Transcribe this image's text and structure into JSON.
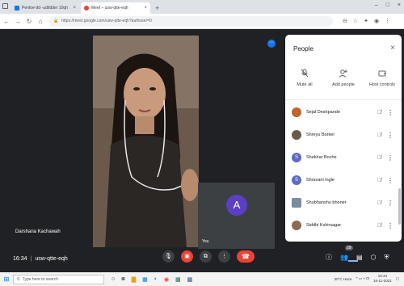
{
  "browser": {
    "tabs": [
      {
        "title": "Pentoe·dd··udtldder 10qh",
        "active": false,
        "favicon_color": "#1a73e8"
      },
      {
        "title": "Meet – usw-qtte-eqh",
        "active": true,
        "favicon_color": "#ea4335"
      }
    ],
    "new_tab_symbol": "+",
    "address_url": "https://meet.google.com/usw-qtte-eqh?authuser=0",
    "window_controls": [
      "–",
      "□",
      "×"
    ]
  },
  "meet": {
    "main_speaker_name": "Darshana Kachawah",
    "self_tile": {
      "avatar_letter": "A",
      "label": "You",
      "avatar_color": "#5b3fc4"
    },
    "pin_symbol": "⋯",
    "time": "16:34",
    "meeting_code": "usw-qtte-eqh",
    "participant_badge": "29",
    "accent_blue": "#1a73e8",
    "danger_red": "#ea4335"
  },
  "people_panel": {
    "title": "People",
    "close_symbol": "×",
    "actions": [
      {
        "label": "Mute all",
        "icon": "mic-off-icon",
        "glyph": "🎙"
      },
      {
        "label": "Add people",
        "icon": "person-add-icon",
        "glyph": "⚲"
      },
      {
        "label": "Host controls",
        "icon": "shield-icon",
        "glyph": "▭"
      }
    ],
    "participants": [
      {
        "name": "Sejal Deshpande",
        "avatar_color": "#c2622d",
        "initial": ""
      },
      {
        "name": "Shreyu Borker",
        "avatar_color": "#6b5a4b",
        "initial": ""
      },
      {
        "name": "Shekhar Boche",
        "avatar_color": "#5c6bc0",
        "initial": "S"
      },
      {
        "name": "Shravani ingle",
        "avatar_color": "#5c6bc0",
        "initial": "S"
      },
      {
        "name": "Shubhanshu bhoner",
        "avatar_color": "#7a8ca0",
        "initial": ""
      },
      {
        "name": "Siddhi Kshirsagar",
        "avatar_color": "#8c6b55",
        "initial": ""
      }
    ]
  },
  "taskbar": {
    "search_placeholder": "Type here to search",
    "time": "16:34",
    "date": "16-11-2021",
    "weather": "30°C Haze"
  }
}
